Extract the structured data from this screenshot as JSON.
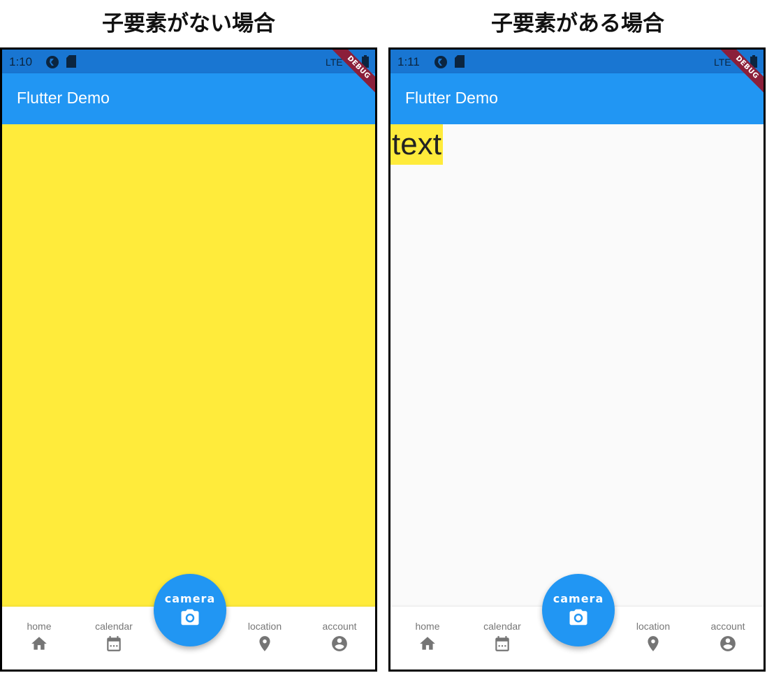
{
  "captions": {
    "left": "子要素がない場合",
    "right": "子要素がある場合"
  },
  "colors": {
    "appbar": "#2196f3",
    "statusbar": "#1976d2",
    "yellow": "#ffeb3b",
    "debug": "#8b1f3a",
    "nav_gray": "#757575"
  },
  "phone_left": {
    "status": {
      "time": "1:10",
      "network": "LTE"
    },
    "appbar_title": "Flutter Demo",
    "debug_banner": "DEBUG",
    "nav": {
      "home": "home",
      "calendar": "calendar",
      "location": "location",
      "account": "account"
    },
    "fab_label": "camera"
  },
  "phone_right": {
    "status": {
      "time": "1:11",
      "network": "LTE"
    },
    "appbar_title": "Flutter Demo",
    "debug_banner": "DEBUG",
    "body_text": "text",
    "nav": {
      "home": "home",
      "calendar": "calendar",
      "location": "location",
      "account": "account"
    },
    "fab_label": "camera"
  },
  "icons": {
    "nav": [
      "home-icon",
      "calendar-icon",
      "location-icon",
      "account-icon"
    ],
    "fab": "camera-icon",
    "status": [
      "flutter-notification-icon",
      "sd-card-icon",
      "signal-icon",
      "battery-icon"
    ]
  }
}
